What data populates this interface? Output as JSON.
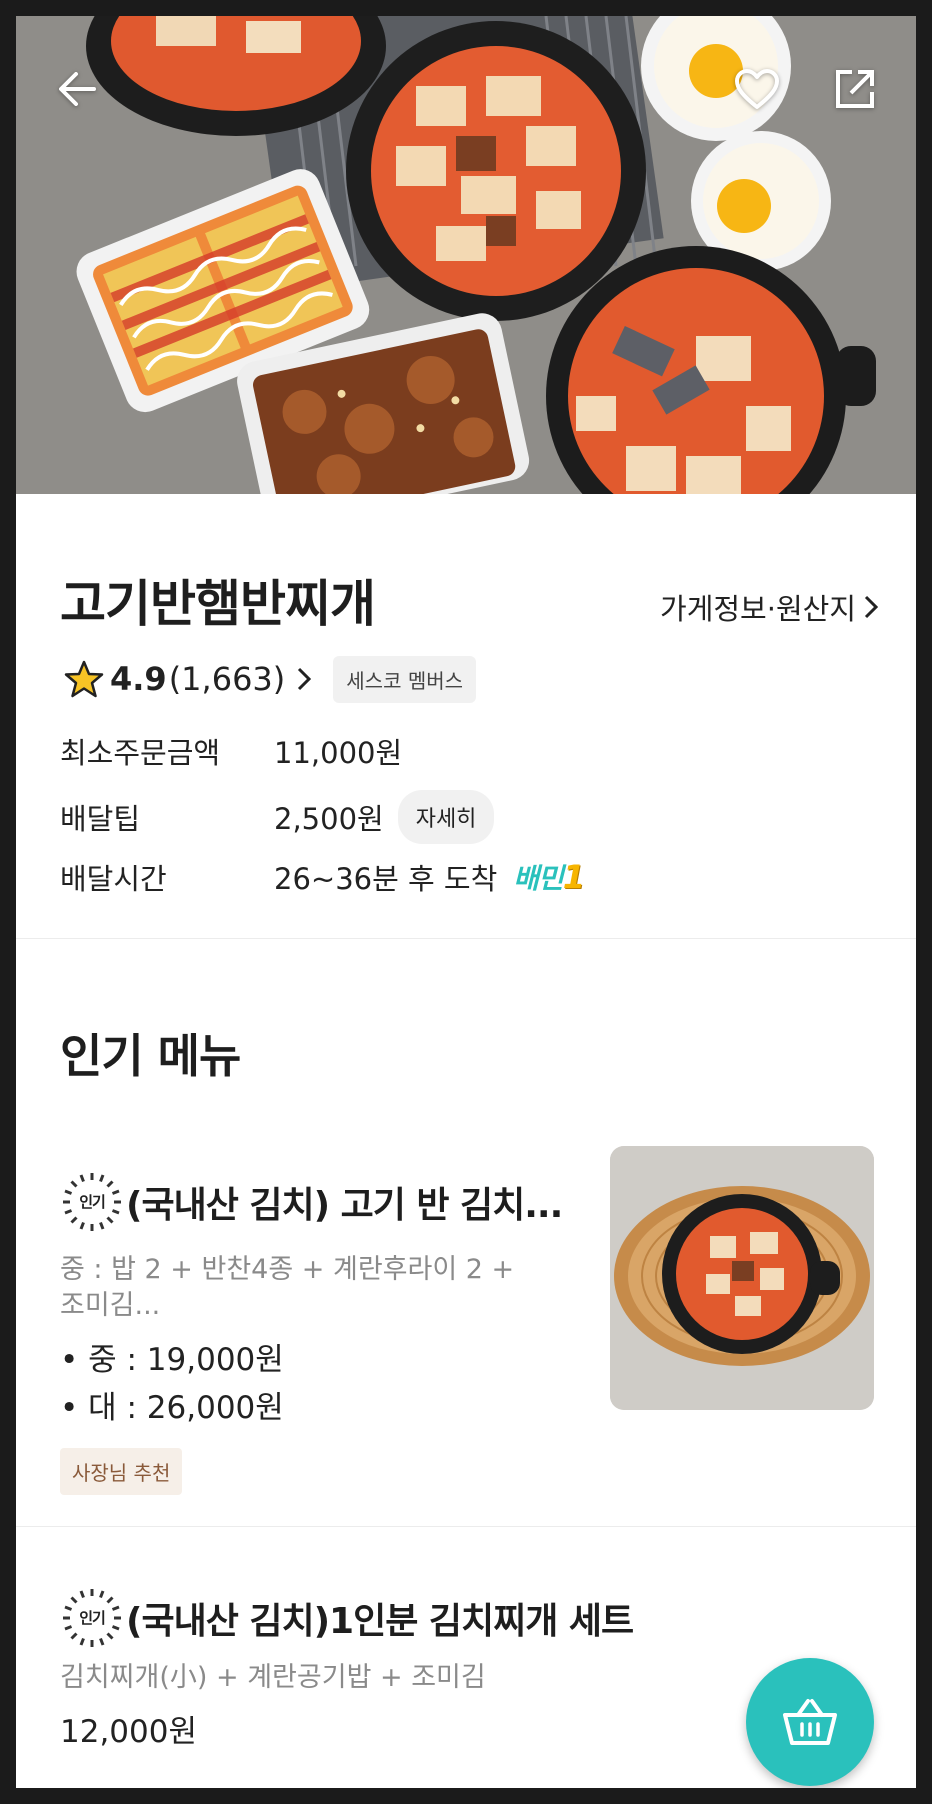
{
  "store": {
    "name": "고기반햄반찌개",
    "info_link": "가게정보·원산지",
    "rating": "4.9",
    "review_count": "(1,663)",
    "member_badge": "세스코 멤버스"
  },
  "info": {
    "min_order_label": "최소주문금액",
    "min_order_value": "11,000원",
    "delivery_tip_label": "배달팁",
    "delivery_tip_value": "2,500원",
    "detail_button": "자세히",
    "delivery_time_label": "배달시간",
    "delivery_time_value": "26~36분 후 도착",
    "baemin1_text": "배민",
    "baemin1_num": "1"
  },
  "popular": {
    "title": "인기 메뉴",
    "badge_text": "인기",
    "items": [
      {
        "name": "(국내산 김치) 고기 반 김치...",
        "desc_line1": "중 : 밥 2 + 반찬4종 + 계란후라이 2 +",
        "desc_line2": "조미김...",
        "price1": "• 중 : 19,000원",
        "price2": "• 대 : 26,000원",
        "tag": "사장님 추천"
      },
      {
        "name": "(국내산 김치)1인분 김치찌개 세트",
        "desc": "김치찌개(小) + 계란공기밥 + 조미김",
        "price": "12,000원"
      }
    ]
  },
  "icons": {
    "back": "back-arrow-icon",
    "favorite": "heart-icon",
    "share": "share-icon",
    "cart": "cart-icon",
    "rating": "star-icon"
  },
  "colors": {
    "accent": "#2ac1bc",
    "star": "#f7c325"
  }
}
